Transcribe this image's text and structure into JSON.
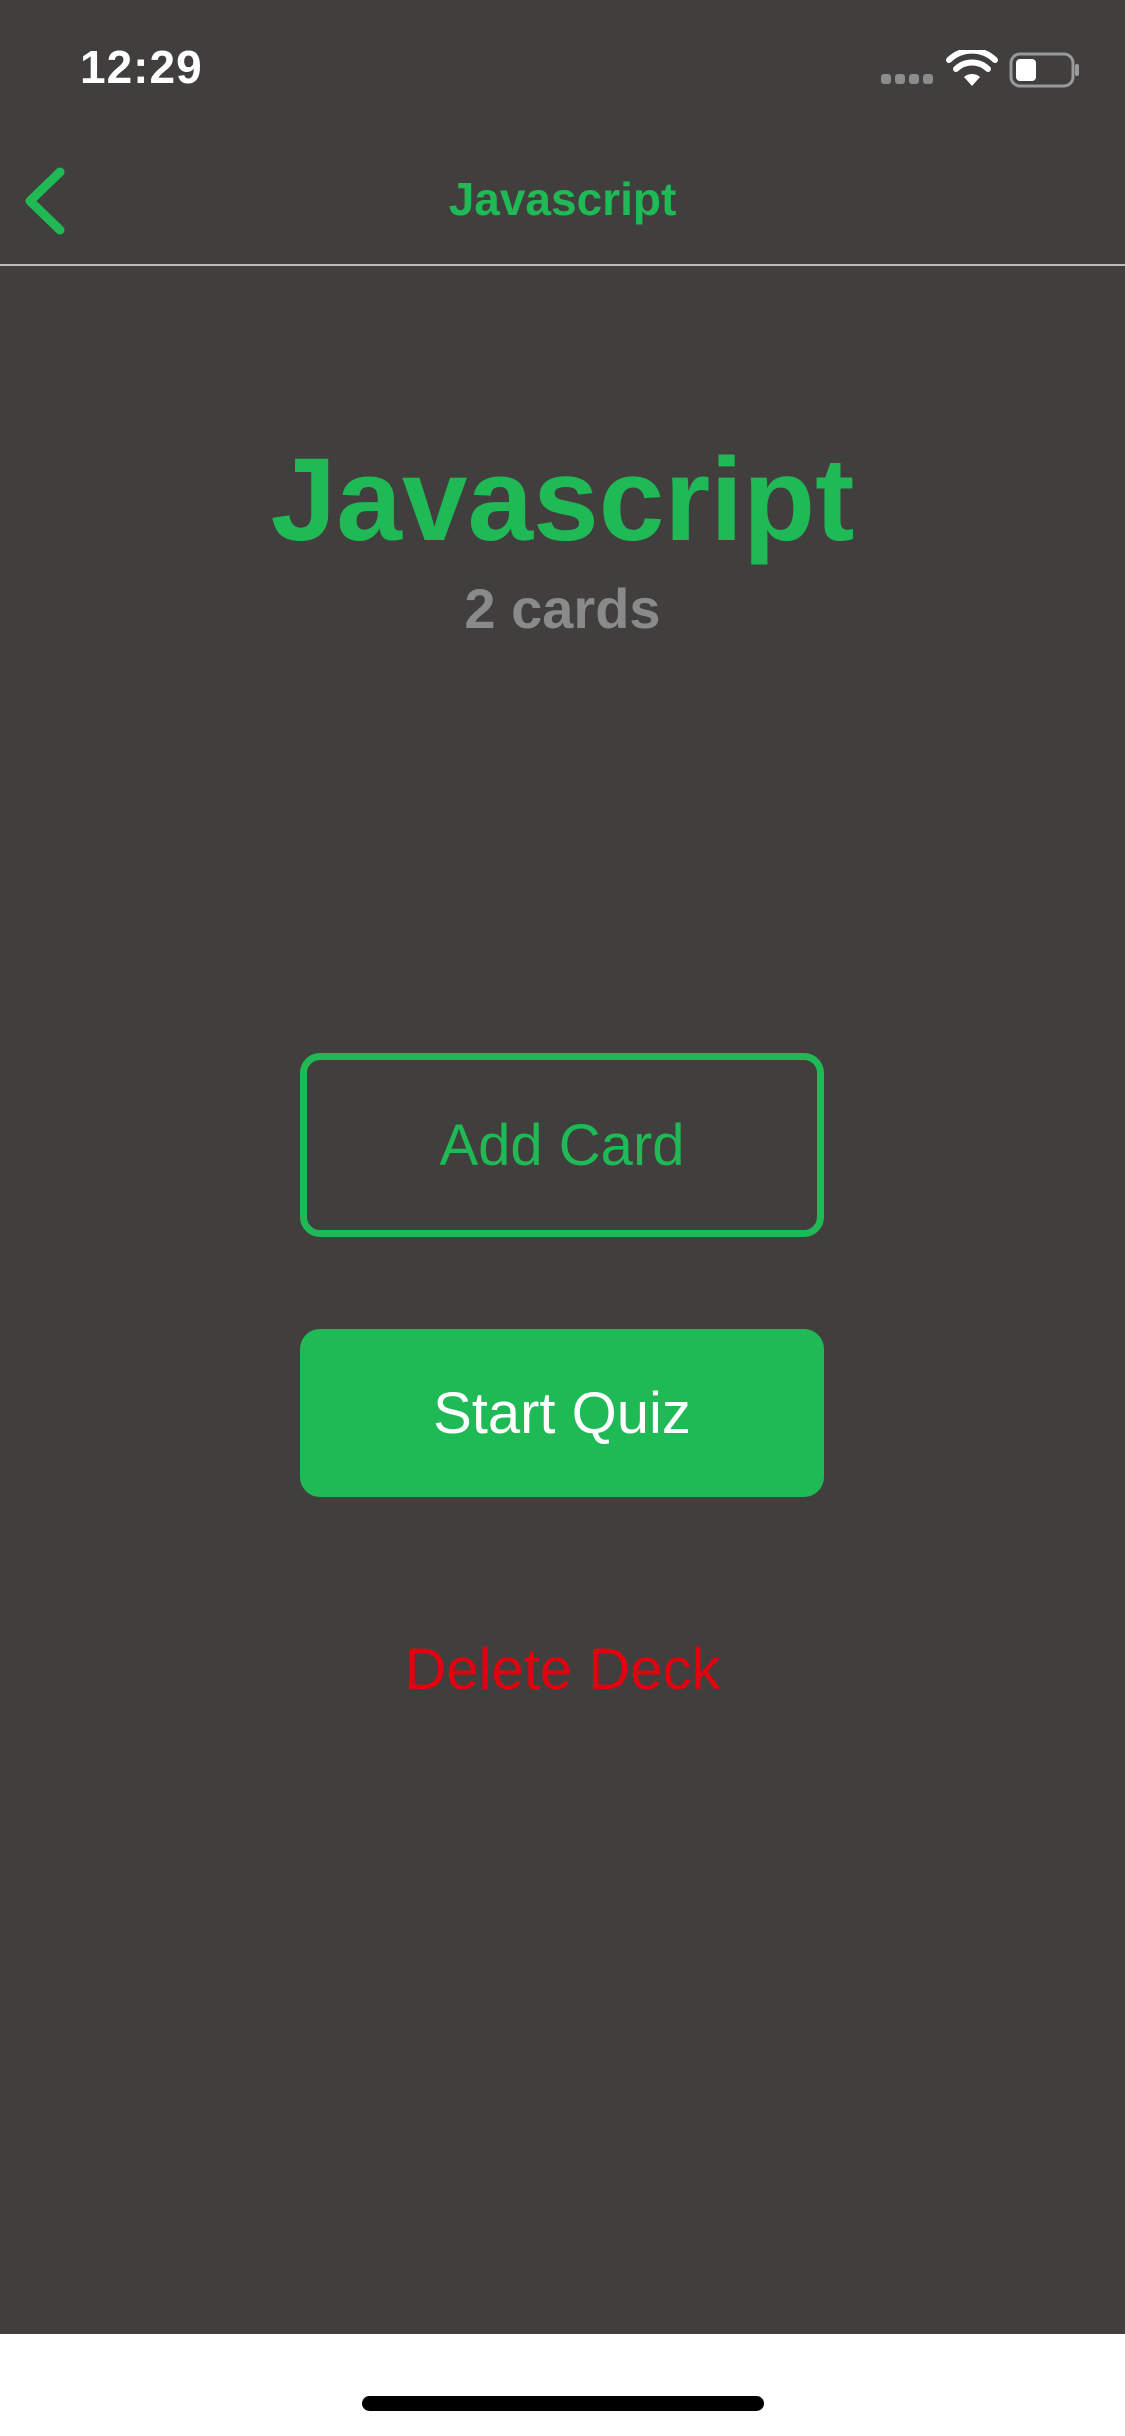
{
  "status_bar": {
    "time": "12:29"
  },
  "nav": {
    "back_icon": "chevron-left-icon",
    "title": "Javascript"
  },
  "deck": {
    "title": "Javascript",
    "card_count": "2 cards"
  },
  "actions": {
    "add_card_label": "Add Card",
    "start_quiz_label": "Start Quiz",
    "delete_deck_label": "Delete Deck"
  },
  "colors": {
    "background": "#403f3e",
    "accent": "#1fba55",
    "muted": "#8a8a8a",
    "danger": "#e3000f",
    "home_area": "#ffffff"
  }
}
